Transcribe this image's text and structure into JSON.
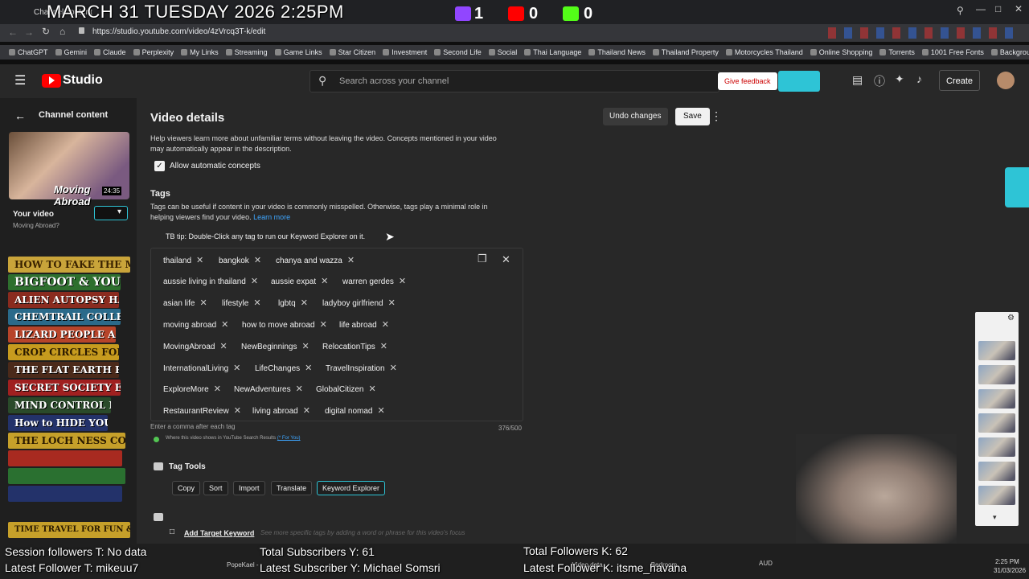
{
  "overlay": {
    "date_time": "MARCH 31 TUESDAY 2026 2:25PM",
    "twitch_count": "1",
    "youtube_count": "0",
    "kick_count": "0",
    "session_followers": "Session followers T: No data",
    "latest_follower_t": "Latest Follower T: mikeuu7",
    "total_subscribers": "Total Subscribers Y: 61",
    "latest_subscriber": "Latest Subscriber Y: Michael Somsri",
    "total_followers_k": "Total Followers K: 62",
    "latest_follower_k": "Latest Follower K: itsme_havana"
  },
  "browser": {
    "tab1": "Channel content",
    "url": "https://studio.youtube.com/video/4zVrcq3T-k/edit",
    "bookmarks": [
      "ChatGPT",
      "Gemini",
      "Claude",
      "Perplexity",
      "My Links",
      "Streaming",
      "Game Links",
      "Star Citizen",
      "Investment",
      "Second Life",
      "Social",
      "Thai Language",
      "Thailand News",
      "Thailand Property",
      "Motorcycles Thailand",
      "Online Shopping",
      "Torrents",
      "1001 Free Fonts",
      "Background Remover"
    ]
  },
  "header": {
    "logo": "Studio",
    "search_placeholder": "Search across your channel",
    "feedback": "Give feedback",
    "create": "Create"
  },
  "sidebar": {
    "back_label": "Channel content",
    "duration": "24:35",
    "thumb_title": "Moving Abroad",
    "your_video": "Your video",
    "video_name": "Moving Abroad?",
    "books": [
      "HOW TO FAKE THE MOON LANDING",
      "BIGFOOT & YOU",
      "ALIEN AUTOPSY HANDBOOK",
      "CHEMTRAIL COLLECTION GUIDE",
      "LIZARD PEOPLE AMONG US",
      "CROP CIRCLES FOR DUMMIES",
      "THE FLAT EARTH PRIMER",
      "SECRET SOCIETY ETIQUETTE",
      "MIND CONTROL MADE EASY",
      "How to HIDE YOUR BUNKER",
      "THE LOCH NESS CONSPIRACY",
      "",
      "",
      "",
      "TIME TRAVEL FOR FUN & PROFIT"
    ]
  },
  "page": {
    "title": "Video details",
    "undo": "Undo changes",
    "save": "Save",
    "concepts_desc": "Help viewers learn more about unfamiliar terms without leaving the video. Concepts mentioned in your video may automatically appear in the description.",
    "allow_concepts": "Allow automatic concepts",
    "tags_heading": "Tags",
    "tags_desc": "Tags can be useful if content in your video is commonly misspelled. Otherwise, tags play a minimal role in helping viewers find your video.",
    "learn_more": "Learn more",
    "tb_tip": "TB tip: Double-Click any tag to run our Keyword Explorer on it.",
    "tags": [
      [
        "thailand",
        "bangkok",
        "chanya and wazza"
      ],
      [
        "aussie living in thailand",
        "aussie expat",
        "warren gerdes"
      ],
      [
        "asian life",
        "lifestyle",
        "lgbtq",
        "ladyboy girlfriend"
      ],
      [
        "moving abroad",
        "how to move abroad",
        "life abroad"
      ],
      [
        "MovingAbroad",
        "NewBeginnings",
        "RelocationTips"
      ],
      [
        "InternationalLiving",
        "LifeChanges",
        "TravelInspiration"
      ],
      [
        "ExploreMore",
        "NewAdventures",
        "GlobalCitizen"
      ],
      [
        "RestaurantReview",
        "living abroad",
        "digital nomad"
      ]
    ],
    "comma_hint": "Enter a comma after each tag",
    "char_count": "376/500",
    "where_shown": "Where this video shows in YouTube Search Results",
    "for_you": "(* For You)",
    "tag_tools": "Tag Tools",
    "tools": [
      "Copy",
      "Sort",
      "Import",
      "Translate",
      "Keyword Explorer"
    ],
    "add_target": "Add Target Keyword",
    "add_target_hint": "See more specific tags by adding a word or phrase for this video's focus"
  },
  "taskbar": {
    "items": [
      "PopeKael -",
      "Video deta",
      "Bedroom",
      "AUD"
    ],
    "time": "2:25 PM",
    "date": "31/03/2026"
  },
  "colors": {
    "accent": "#3ea6ff",
    "twitch": "#9146ff",
    "youtube": "#ff0000",
    "kick": "#53fc18",
    "chip_bg": "#3a3a3a"
  }
}
